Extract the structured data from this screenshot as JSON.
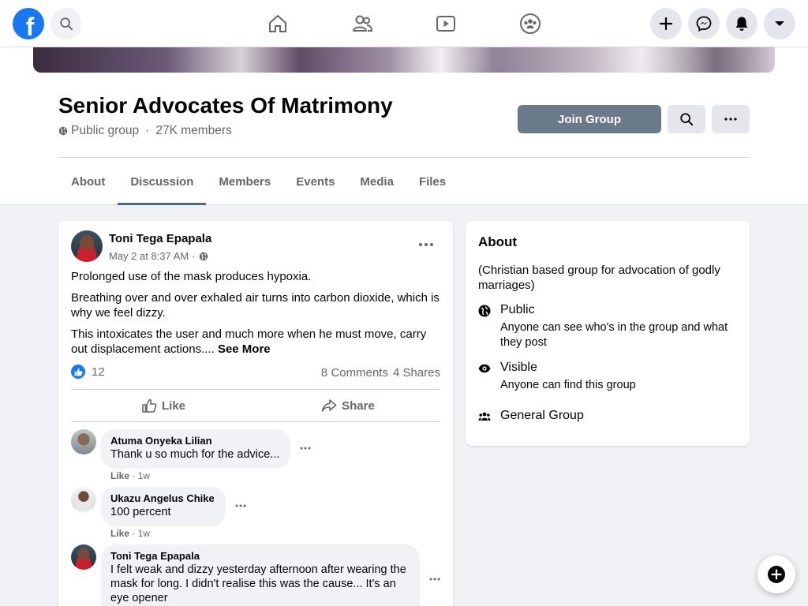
{
  "nav": {
    "icons": [
      "facebook-logo",
      "search-icon",
      "home-icon",
      "friends-icon",
      "watch-icon",
      "groups-icon",
      "plus-icon",
      "messenger-icon",
      "notifications-icon",
      "account-menu-icon"
    ]
  },
  "group": {
    "title": "Senior Advocates Of Matrimony",
    "privacy": "Public group",
    "separator": "·",
    "members": "27K members",
    "join_label": "Join Group",
    "tabs": [
      {
        "label": "About"
      },
      {
        "label": "Discussion"
      },
      {
        "label": "Members"
      },
      {
        "label": "Events"
      },
      {
        "label": "Media"
      },
      {
        "label": "Files"
      }
    ],
    "active_tab": "Discussion"
  },
  "post": {
    "author": "Toni Tega Epapala",
    "time": "May 2 at 8:37 AM",
    "dot": "·",
    "paragraphs": [
      "Prolonged use of the mask produces hypoxia.",
      " Breathing over and over exhaled air turns into carbon dioxide, which is why we feel dizzy.",
      " This intoxicates the user and much more when he must move, carry out displacement actions.... "
    ],
    "see_more": "See More",
    "like_count": "12",
    "comments_count": "8 Comments",
    "shares_count": "4 Shares",
    "like_label": "Like",
    "share_label": "Share",
    "comments": [
      {
        "name": "Atuma Onyeka Lilian",
        "text": "Thank u so much for the advice...",
        "like": "Like",
        "dot": " · ",
        "time": "1w"
      },
      {
        "name": "Ukazu Angelus Chike",
        "text": "100 percent",
        "like": "Like",
        "dot": " · ",
        "time": "1w"
      },
      {
        "name": "Toni Tega Epapala",
        "text": "I felt weak and dizzy yesterday afternoon after wearing the mask for long. I didn't realise this was the cause... It's an eye opener"
      }
    ]
  },
  "about": {
    "title": "About",
    "description": "(Christian based group for advocation of godly marriages)",
    "public_label": "Public",
    "public_sub": "Anyone can see who's in the group and what they post",
    "visible_label": "Visible",
    "visible_sub": "Anyone can find this group",
    "type_label": "General Group"
  },
  "colors": {
    "brand": "#1877f2",
    "join_button": "#6b7a8a",
    "secondary_text": "#65676b"
  }
}
